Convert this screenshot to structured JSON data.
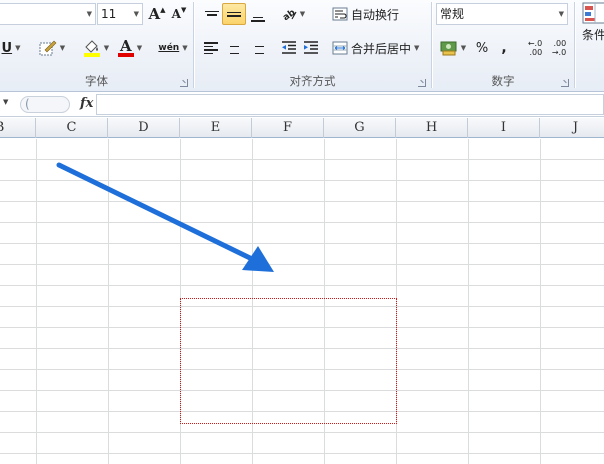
{
  "ribbon": {
    "font_group": {
      "label": "字体",
      "font_size": "11",
      "grow_font_icon": "A",
      "shrink_font_icon": "A",
      "underline_icon": "U",
      "font_color_icon": "A",
      "phonetic_icon": "wén"
    },
    "alignment_group": {
      "label": "对齐方式",
      "wrap_text": "自动换行",
      "merge_center": "合并后居中"
    },
    "number_group": {
      "label": "数字",
      "format": "常规",
      "percent": "%",
      "comma": ",",
      "increase_decimal_top": "←.0",
      "increase_decimal_bottom": ".00",
      "decrease_decimal_top": ".00",
      "decrease_decimal_bottom": "→.0"
    },
    "conditional_format": "条件"
  },
  "formula_bar": {
    "fx_label": "fx",
    "value": ""
  },
  "columns": [
    "B",
    "C",
    "D",
    "E",
    "F",
    "G",
    "H",
    "I",
    "J"
  ],
  "colors": {
    "arrow": "#1e6fd9",
    "selection_border": "#d01818",
    "highlight": "#fbd36b"
  }
}
